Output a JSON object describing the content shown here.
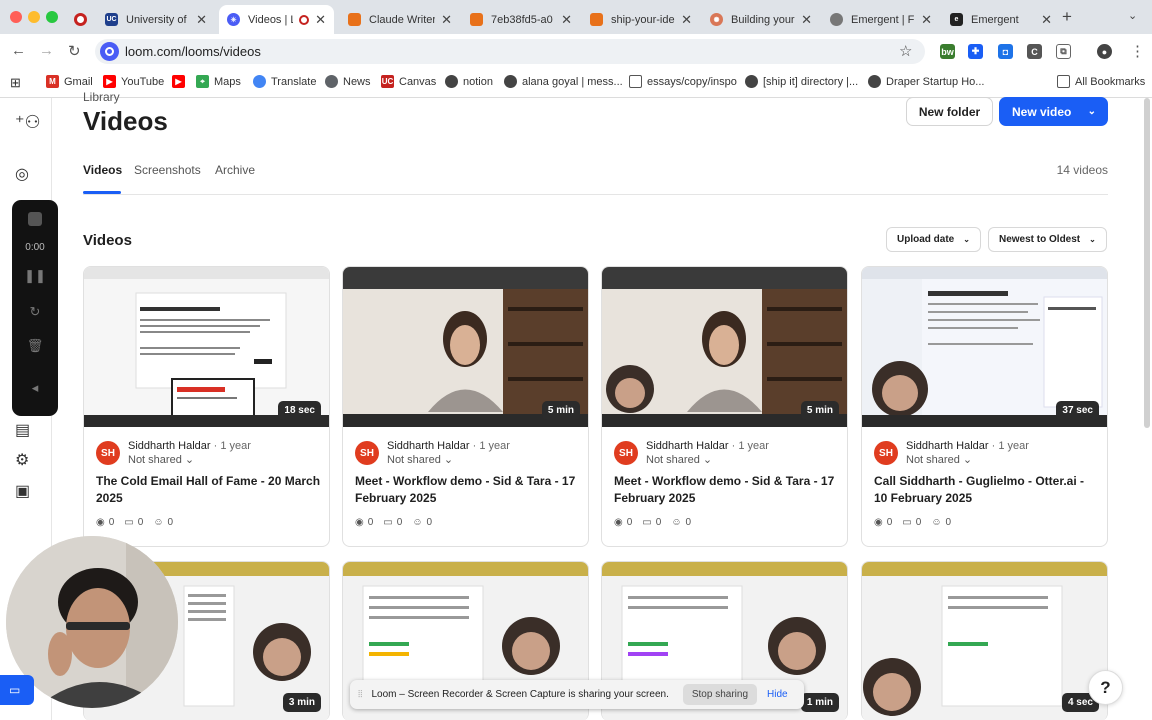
{
  "browser": {
    "tabs": [
      {
        "title": "",
        "favicon_color": "#c5221f",
        "recording": false
      },
      {
        "title": "University of",
        "favicon_color": "#1f3f8c",
        "favicon_text": "UC",
        "recording": false
      },
      {
        "title": "Videos | L",
        "favicon_color": "#4a5cf5",
        "recording": true,
        "active": true
      },
      {
        "title": "Claude Writer",
        "favicon_color": "#e8711a"
      },
      {
        "title": "7eb38fd5-a0",
        "favicon_color": "#e8711a"
      },
      {
        "title": "ship-your-ide",
        "favicon_color": "#e8711a"
      },
      {
        "title": "Building your",
        "favicon_color": "#d97757"
      },
      {
        "title": "Emergent | Fu",
        "favicon_color": "#777777"
      },
      {
        "title": "Emergent",
        "favicon_color": "#222222"
      }
    ],
    "url": "loom.com/looms/videos",
    "bookmarks": [
      {
        "label": "Gmail",
        "color": "#d93025"
      },
      {
        "label": "YouTube",
        "color": "#ff0000"
      },
      {
        "label": "",
        "color": "#ff0000"
      },
      {
        "label": "Maps",
        "color": "#34a853"
      },
      {
        "label": "Translate",
        "color": "#4285f4"
      },
      {
        "label": "News",
        "color": "#5f6368"
      },
      {
        "label": "Canvas",
        "color": "#c5221f",
        "icon_text": "UC"
      },
      {
        "label": "notion",
        "color": "#444444"
      },
      {
        "label": "alana goyal | mess...",
        "color": "#444444"
      },
      {
        "label": "essays/copy/inspo",
        "color": "#444444"
      },
      {
        "label": "[ship it] directory |...",
        "color": "#444444"
      },
      {
        "label": "Draper Startup Ho...",
        "color": "#444444"
      }
    ],
    "all_bookmarks": "All Bookmarks"
  },
  "page": {
    "breadcrumb": "Library",
    "title": "Videos",
    "new_folder": "New folder",
    "new_video": "New video",
    "tabs": [
      "Videos",
      "Screenshots",
      "Archive"
    ],
    "count": "14 videos",
    "section": "Videos",
    "sort_field": "Upload date",
    "sort_order": "Newest to Oldest"
  },
  "videos": [
    {
      "author": "Siddharth Haldar",
      "ago": "· 1 year",
      "share": "Not shared",
      "title": "The Cold Email Hall of Fame - 20 March 2025",
      "duration": "18 sec",
      "views": "0",
      "comments": "0",
      "reactions": "0"
    },
    {
      "author": "Siddharth Haldar",
      "ago": "· 1 year",
      "share": "Not shared",
      "title": "Meet - Workflow demo - Sid & Tara - 17 February 2025",
      "duration": "5 min",
      "views": "0",
      "comments": "0",
      "reactions": "0"
    },
    {
      "author": "Siddharth Haldar",
      "ago": "· 1 year",
      "share": "Not shared",
      "title": "Meet - Workflow demo - Sid & Tara - 17 February 2025",
      "duration": "5 min",
      "views": "0",
      "comments": "0",
      "reactions": "0"
    },
    {
      "author": "Siddharth Haldar",
      "ago": "· 1 year",
      "share": "Not shared",
      "title": "Call Siddharth - Guglielmo - Otter.ai - 10 February 2025",
      "duration": "37 sec",
      "views": "0",
      "comments": "0",
      "reactions": "0"
    }
  ],
  "videos_row2": [
    {
      "duration": "3 min"
    },
    {
      "duration": ""
    },
    {
      "duration": "1 min"
    },
    {
      "duration": "4 sec"
    }
  ],
  "avatar_initials": "SH",
  "recorder": {
    "time": "0:00"
  },
  "share_banner": {
    "message": "Loom – Screen Recorder & Screen Capture is sharing your screen.",
    "stop": "Stop sharing",
    "hide": "Hide"
  },
  "help": "?",
  "colors": {
    "accent": "#1a5ef5",
    "avatar": "#e03c1f"
  }
}
